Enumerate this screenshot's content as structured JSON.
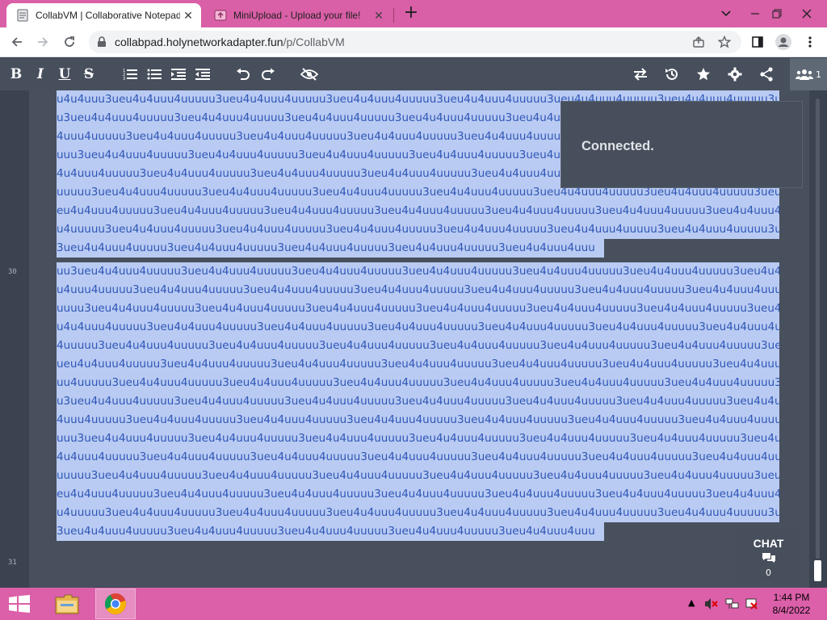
{
  "browser": {
    "tabs": [
      {
        "title": "CollabVM | Collaborative Notepad",
        "active": true,
        "icon": "pad-icon"
      },
      {
        "title": "MiniUpload - Upload your file!",
        "active": false,
        "icon": "upload-icon"
      }
    ],
    "url_host": "collabpad.holynetworkadapter.fun",
    "url_path": "/p/CollabVM"
  },
  "pad": {
    "toolbar_left": [
      "bold",
      "italic",
      "underline",
      "strikethrough",
      "ordered-list",
      "unordered-list",
      "indent",
      "outdent",
      "undo",
      "redo",
      "clear-authorship"
    ],
    "toolbar_right": [
      "import-export",
      "timeslider",
      "saved-revision",
      "settings",
      "share"
    ],
    "user_count": "1",
    "line_numbers": {
      "first": "30",
      "second": "31"
    },
    "lines": [
      "u4u4uuu3ueu4u4uuu4uuuuu3ueu4u4uuu4uuuuu3ueu4u4uuu4uuuuu3ueu4u4uuu4uuuuu3ueu4u4uuu4uuuuu3ueu4u4uuu4uuuuu3ueu4u4uuu4uuuu",
      "u3ueu4u4uuu4uuuuu3ueu4u4uuu4uuuuu3ueu4u4uuu4uuuuu3ueu4u4uuu4uuuuu3ueu4u4uuu4uuuuu3ueu4u4uuu4uuuuu3ueu4u4uuu4uuuuu3ueu",
      "4uuu4uuuuu3ueu4u4uuu4uuuuu3ueu4u4uuu4uuuuu3ueu4u4uuu4uuuuu3ueu4u4uuu4uuuuu3ueu4u4uuu4uuuuu3ueu4u4uuu4uuuuu3ueu4u4uuu4",
      "uuu3ueu4u4uuu4uuuuu3ueu4u4uuu4uuuuu3ueu4u4uuu4uuuuu3ueu4u4uuu4uuuuu3ueu4u4uuu4uuuuu3ueu4u4uuu4uuuuu3ueu4u4uuu4uuuuu3u",
      "4u4uuu4uuuuu3ueu4u4uuu4uuuuu3ueu4u4uuu4uuuuu3ueu4u4uuu4uuuuu3ueu4u4uuu4uuuuu3ueu4u4uuu4uuuuu3ueu4u4uuu4uuuuu3ueu4u4uu",
      "uuuuu3ueu4u4uuu4uuuuu3ueu4u4uuu4uuuuu3ueu4u4uuu4uuuuu3ueu4u4uuu4uuuuu3ueu4u4uuu4uuuuu3ueu4u4uuu4uuuuu3ueu4u4uuu4uuuuu3u",
      "eu4u4uuu4uuuuu3ueu4u4uuu4uuuuu3ueu4u4uuu4uuuuu3ueu4u4uuu4uuuuu3ueu4u4uuu4uuuuu3ueu4u4uuu4uuuuu3ueu4u4uuu4uuuuu3ueu4u4u",
      "u4uuuuu3ueu4u4uuu4uuuuu3ueu4u4uuu4uuuuu3ueu4u4uuu4uuuuu3ueu4u4uuu4uuuuu3ueu4u4uuu4uuuuu3ueu4u4uuu4uuuuu3ueu4u4uuu4uuuu",
      "3ueu4u4uuu4uuuuu3ueu4u4uuu4uuuuu3ueu4u4uuu4uuuuu3ueu4u4uuu4uuuuu3ueu4u4uuu4uuu",
      "uu3ueu4u4uuu4uuuuu3ueu4u4uuu4uuuuu3ueu4u4uuu4uuuuu3ueu4u4uuu4uuuuu3ueu4u4uuu4uuuuu3ueu4u4uuu4uuuuu3ueu4u4uuu4uuuuu3ueu4",
      "u4uuu4uuuuu3ueu4u4uuu4uuuuu3ueu4u4uuu4uuuuu3ueu4u4uuu4uuuuu3ueu4u4uuu4uuuuu3ueu4u4uuu4uuuuu3ueu4u4uuu4uuuuu3ueu4u4uuu4u",
      "uuuu3ueu4u4uuu4uuuuu3ueu4u4uuu4uuuuu3ueu4u4uuu4uuuuu3ueu4u4uuu4uuuuu3ueu4u4uuu4uuuuu3ueu4u4uuu4uuuuu3ueu4u4uuu4uuuuu3ue",
      "u4u4uuu4uuuuu3ueu4u4uuu4uuuuu3ueu4u4uuu4uuuuu3ueu4u4uuu4uuuuu3ueu4u4uuu4uuuuu3ueu4u4uuu4uuuuu3ueu4u4uuu4uuuuu3ueu4u4uuu",
      "4uuuuu3ueu4u4uuu4uuuuu3ueu4u4uuu4uuuuu3ueu4u4uuu4uuuuu3ueu4u4uuu4uuuuu3ueu4u4uuu4uuuuu3ueu4u4uuu4uuuuu3ueu4u4uuu4uuuuu3",
      "ueu4u4uuu4uuuuu3ueu4u4uuu4uuuuu3ueu4u4uuu4uuuuu3ueu4u4uuu4uuuuu3ueu4u4uuu4uuuuu3ueu4u4uuu4uuuuu3ueu4u4uuu4uuuuu3ueu4u4u",
      "uu4uuuuu3ueu4u4uuu4uuuuu3ueu4u4uuu4uuuuu3ueu4u4uuu4uuuuu3ueu4u4uuu4uuuuu3ueu4u4uuu4uuuuu3ueu4u4uuu4uuuuu3ueu4u4uuu4uuuu",
      "u3ueu4u4uuu4uuuuu3ueu4u4uuu4uuuuu3ueu4u4uuu4uuuuu3ueu4u4uuu4uuuuu3ueu4u4uuu4uuuuu3ueu4u4uuu4uuuuu3ueu4u4uuu4uuuuu3ueu4u",
      "4uuu4uuuuu3ueu4u4uuu4uuuuu3ueu4u4uuu4uuuuu3ueu4u4uuu4uuuuu3ueu4u4uuu4uuuuu3ueu4u4uuu4uuuuu3ueu4u4uuu4uuuuu3ueu4u4uuu4uu",
      "uuu3ueu4u4uuu4uuuuu3ueu4u4uuu4uuuuu3ueu4u4uuu4uuuuu3ueu4u4uuu4uuuuu3ueu4u4uuu4uuuuu3ueu4u4uuu4uuuuu3ueu4u4uuu4uuuuu3ueu",
      "4u4uuu4uuuuu3ueu4u4uuu4uuuuu3ueu4u4uuu4uuuuu3ueu4u4uuu4uuuuu3ueu4u4uuu4uuuuu3ueu4u4uuu4uuuuu3ueu4u4uuu4uuuuu3ueu4u4uuu4",
      "uuuuu3ueu4u4uuu4uuuuu3ueu4u4uuu4uuuuu3ueu4u4uuu4uuuuu3ueu4u4uuu4uuuuu3ueu4u4uuu4uuuuu3ueu4u4uuu4uuuuu3ueu4u4uuu4uuuuu3u",
      "eu4u4uuu4uuuuu3ueu4u4uuu4uuuuu3ueu4u4uuu4uuuuu3ueu4u4uuu4uuuuu3ueu4u4uuu4uuuuu3ueu4u4uuu4uuuuu3ueu4u4uuu4uuuuu3ueu4u4u",
      "u4uuuuu3ueu4u4uuu4uuuuu3ueu4u4uuu4uuuuu3ueu4u4uuu4uuuuu3ueu4u4uuu4uuuuu3ueu4u4uuu4uuuuu3ueu4u4uuu4uuuuu3ueu4u4uuu4uuuu",
      "3ueu4u4uuu4uuuuu3ueu4u4uuu4uuuuu3ueu4u4uuu4uuuuu3ueu4u4uuu4uuuuu3ueu4u4uuu4uuu"
    ],
    "notification": "Connected.",
    "chat": {
      "label": "CHAT",
      "count": "0"
    }
  },
  "taskbar": {
    "apps": [
      "file-explorer",
      "chrome"
    ],
    "time": "1:44 PM",
    "date": "8/4/2022"
  },
  "colors": {
    "tabstrip": "#d95fa6",
    "padbar": "#474f5c",
    "editor_bg": "#48505d",
    "selection": "#b9cbf3",
    "selected_text": "#2f56b6",
    "taskbar": "#db5fa9"
  }
}
